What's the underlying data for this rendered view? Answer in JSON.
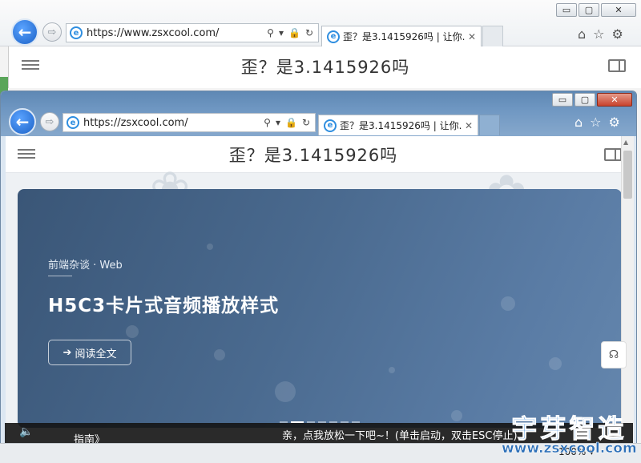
{
  "back_window": {
    "address": "https://www.zsxcool.com/",
    "tab_title": "歪？是3.1415926吗 | 让你...",
    "site_title": "歪？是3.1415926吗"
  },
  "front_window": {
    "address": "https://zsxcool.com/",
    "tab_title": "歪？是3.1415926吗 | 让你...",
    "site_title": "歪？是3.1415926吗"
  },
  "caption": {
    "minimize": "▭",
    "maximize": "▢",
    "close": "✕"
  },
  "nav": {
    "back": "←",
    "forward": "⇨"
  },
  "addr_tools": {
    "search": "⚲",
    "dropdown": "▾",
    "lock": "🔒",
    "refresh": "↻"
  },
  "tab_close": "✕",
  "toolbar_icons": {
    "home": "⌂",
    "favorites": "☆",
    "settings": "⚙"
  },
  "hero": {
    "category": "前端杂谈 · Web",
    "title": "H5C3卡片式音频播放样式",
    "read_more": "阅读全文",
    "read_more_icon": "➔",
    "slides_count": 7,
    "active_slide": 1
  },
  "float_help_icon": "☊",
  "music": {
    "speaker_icon": "🔈",
    "guide": "指南》",
    "ticker": "亲，点我放松一下吧~！(单击启动，双击ESC停止)"
  },
  "status": {
    "zoom": "100%",
    "zoom_arrow": "▾"
  },
  "watermark": {
    "big": "宇芽智造",
    "small": "www.zsxcool.com"
  },
  "colors": {
    "hero_start": "#3a5677",
    "hero_end": "#6486ad",
    "ie_blue": "#2f8ee0",
    "nav_blue": "#1c62c7"
  }
}
